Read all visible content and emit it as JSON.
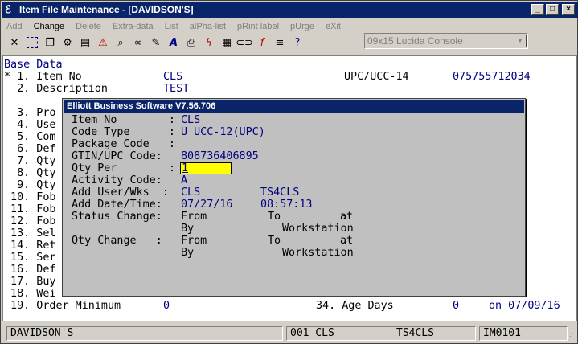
{
  "window": {
    "title": "Item File Maintenance - [DAVIDSON'S]"
  },
  "menu": [
    "Add",
    "Change",
    "Delete",
    "Extra-data",
    "List",
    "alPha-list",
    "pRint label",
    "pUrge",
    "eXit"
  ],
  "font_selector": {
    "value": "09x15 Lucida Console"
  },
  "toolbar_icons": [
    "close-x-icon",
    "select-icon",
    "copy-icon",
    "settings-icon",
    "document-icon",
    "warning-icon",
    "search-icon",
    "binoculars-icon",
    "pencil-icon",
    "font-icon",
    "print-icon",
    "lightning-icon",
    "calculator-icon",
    "link-icon",
    "function-icon",
    "notes-icon",
    "help-icon"
  ],
  "screen": {
    "section": "Base Data",
    "lines": [
      {
        "label": "* 1. Item No",
        "value": "CLS",
        "right_label": "UPC/UCC-14",
        "right_value": "075755712034"
      },
      {
        "label": "  2. Description",
        "value": "TEST"
      },
      {
        "label": "  3. Pro"
      },
      {
        "label": "  4. Use"
      },
      {
        "label": "  5. Com"
      },
      {
        "label": "  6. Def"
      },
      {
        "label": "  7. Qty"
      },
      {
        "label": "  8. Qty"
      },
      {
        "label": "  9. Qty"
      },
      {
        "label": " 10. Fob"
      },
      {
        "label": " 11. Fob"
      },
      {
        "label": " 12. Fob"
      },
      {
        "label": " 13. Sel"
      },
      {
        "label": " 14. Ret"
      },
      {
        "label": " 15. Ser"
      },
      {
        "label": " 16. Def"
      },
      {
        "label": " 17. Buy"
      },
      {
        "label": " 18. Wei"
      },
      {
        "label": " 19. Order Minimum",
        "value": "0",
        "right_label": "34. Age Days",
        "right_value": "0",
        "extra": "on 07/09/16"
      }
    ]
  },
  "dialog": {
    "title": "Elliott Business Software V7.56.706",
    "item_no_label": "Item No        :",
    "item_no": "CLS",
    "code_type_label": "Code Type      :",
    "code_type": "U UCC-12(UPC)",
    "package_code_label": "Package Code   :",
    "gtin_label": "GTIN/UPC Code:",
    "gtin": "808736406895",
    "qty_per_label": "Qty Per        :",
    "qty_per": "1",
    "activity_label": "Activity Code:",
    "activity": "A",
    "add_user_label": "Add User/Wks  :",
    "add_user": "CLS",
    "add_wks": "TS4CLS",
    "add_date_label": "Add Date/Time:",
    "add_date": "07/27/16",
    "add_time": "08:57:13",
    "status_change_label": "Status Change:",
    "status_from": "From",
    "status_to": "To",
    "status_at": "at",
    "status_by": "By",
    "status_ws": "Workstation",
    "qty_change_label": "Qty Change   :",
    "qty_from": "From",
    "qty_to": "To",
    "qty_at": "at",
    "qty_by": "By",
    "qty_ws": "Workstation"
  },
  "statusbar": {
    "company": "DAVIDSON'S",
    "user": "001 CLS",
    "workstation": "TS4CLS",
    "screen_id": "IM0101"
  }
}
